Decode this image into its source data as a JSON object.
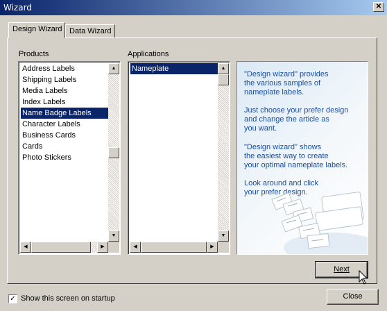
{
  "window": {
    "title": "Wizard",
    "close_glyph": "✕"
  },
  "tabs": [
    {
      "label": "Design Wizard"
    },
    {
      "label": "Data Wizard"
    }
  ],
  "products": {
    "label": "Products",
    "items": [
      "Address Labels",
      "Shipping Labels",
      "Media Labels",
      "Index Labels",
      "Name Badge Labels",
      "Character Labels",
      "Business Cards",
      "Cards",
      "Photo Stickers"
    ],
    "selected": "Name Badge Labels"
  },
  "applications": {
    "label": "Applications",
    "items": [
      "Nameplate"
    ],
    "selected": "Nameplate"
  },
  "info": {
    "p1": [
      "\"Design wizard\" provides",
      "the various samples of",
      "nameplate labels."
    ],
    "p2": [
      "Just choose your prefer design",
      "and change the article as",
      "you want."
    ],
    "p3": [
      "\"Design wizard\" shows",
      "the easiest way to create",
      "your optimal nameplate labels."
    ],
    "p4": [
      "Look around and click",
      "your prefer design."
    ],
    "color": "#1a4fa0"
  },
  "buttons": {
    "next": "Next",
    "close": "Close"
  },
  "startup": {
    "label": "Show this screen on startup",
    "checked": true,
    "check_glyph": "✓"
  },
  "scroll_glyphs": {
    "up": "▲",
    "down": "▼",
    "left": "◀",
    "right": "▶"
  },
  "icons": [
    "close-icon",
    "scroll-up-icon",
    "scroll-down-icon",
    "scroll-left-icon",
    "scroll-right-icon",
    "check-icon",
    "cursor-icon"
  ]
}
